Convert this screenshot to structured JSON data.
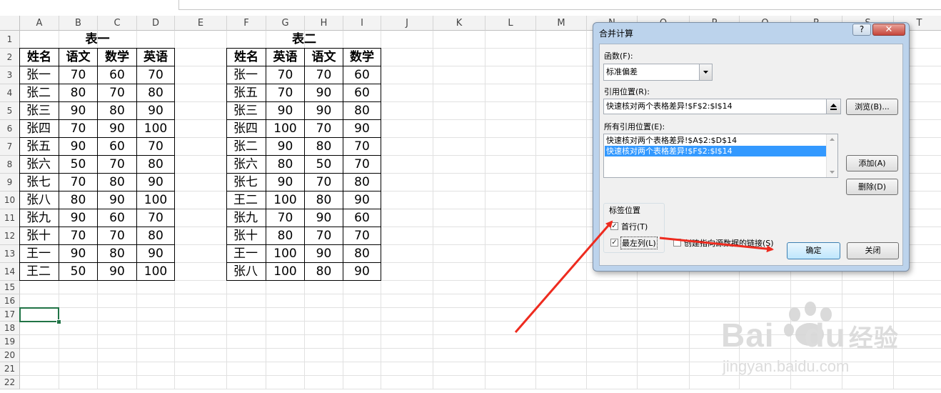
{
  "sheet": {
    "columns": [
      "A",
      "B",
      "C",
      "D",
      "E",
      "F",
      "G",
      "H",
      "I",
      "J",
      "K",
      "L",
      "M",
      "N",
      "O",
      "P",
      "Q",
      "R",
      "S",
      "T"
    ],
    "rows": [
      "1",
      "2",
      "3",
      "4",
      "5",
      "6",
      "7",
      "8",
      "9",
      "10",
      "11",
      "12",
      "13",
      "14",
      "15",
      "16",
      "17",
      "18",
      "19",
      "20",
      "21",
      "22"
    ],
    "table1": {
      "title": "表一",
      "headers": [
        "姓名",
        "语文",
        "数学",
        "英语"
      ],
      "rows": [
        [
          "张一",
          "70",
          "60",
          "70"
        ],
        [
          "张二",
          "80",
          "70",
          "80"
        ],
        [
          "张三",
          "90",
          "80",
          "90"
        ],
        [
          "张四",
          "70",
          "90",
          "100"
        ],
        [
          "张五",
          "90",
          "60",
          "70"
        ],
        [
          "张六",
          "50",
          "70",
          "80"
        ],
        [
          "张七",
          "70",
          "80",
          "90"
        ],
        [
          "张八",
          "80",
          "90",
          "100"
        ],
        [
          "张九",
          "90",
          "60",
          "70"
        ],
        [
          "张十",
          "70",
          "70",
          "80"
        ],
        [
          "王一",
          "90",
          "80",
          "90"
        ],
        [
          "王二",
          "50",
          "90",
          "100"
        ]
      ]
    },
    "table2": {
      "title": "表二",
      "headers": [
        "姓名",
        "英语",
        "语文",
        "数学"
      ],
      "rows": [
        [
          "张一",
          "70",
          "70",
          "60"
        ],
        [
          "张五",
          "70",
          "90",
          "60"
        ],
        [
          "张三",
          "90",
          "90",
          "80"
        ],
        [
          "张四",
          "100",
          "70",
          "90"
        ],
        [
          "张二",
          "90",
          "80",
          "70"
        ],
        [
          "张六",
          "80",
          "50",
          "70"
        ],
        [
          "张七",
          "90",
          "70",
          "80"
        ],
        [
          "王二",
          "100",
          "80",
          "90"
        ],
        [
          "张九",
          "70",
          "90",
          "60"
        ],
        [
          "张十",
          "80",
          "70",
          "70"
        ],
        [
          "王一",
          "100",
          "90",
          "80"
        ],
        [
          "张八",
          "100",
          "80",
          "90"
        ]
      ]
    },
    "selected_cell": "A17"
  },
  "dialog": {
    "title": "合并计算",
    "help_label": "?",
    "close_label": "✕",
    "function_label": "函数(F):",
    "function_value": "标准偏差",
    "reference_label": "引用位置(R):",
    "reference_value": "快速核对两个表格差异!$F$2:$I$14",
    "browse_label": "浏览(B)...",
    "all_refs_label": "所有引用位置(E):",
    "all_refs": [
      "快速核对两个表格差异!$A$2:$D$14",
      "快速核对两个表格差异!$F$2:$I$14"
    ],
    "add_label": "添加(A)",
    "delete_label": "删除(D)",
    "label_pos_label": "标签位置",
    "first_row_label": "首行(T)",
    "left_col_label": "最左列(L)",
    "link_label": "创建指向源数据的链接(S)",
    "ok_label": "确定",
    "cancel_label": "关闭"
  },
  "watermark": {
    "brand": "Bai",
    "brand2": "du",
    "brand_cn": "经验",
    "url": "jingyan.baidu.com"
  },
  "colors": {
    "arrow": "#ee2b1f",
    "selection": "#217346",
    "list_highlight": "#3399ff"
  }
}
